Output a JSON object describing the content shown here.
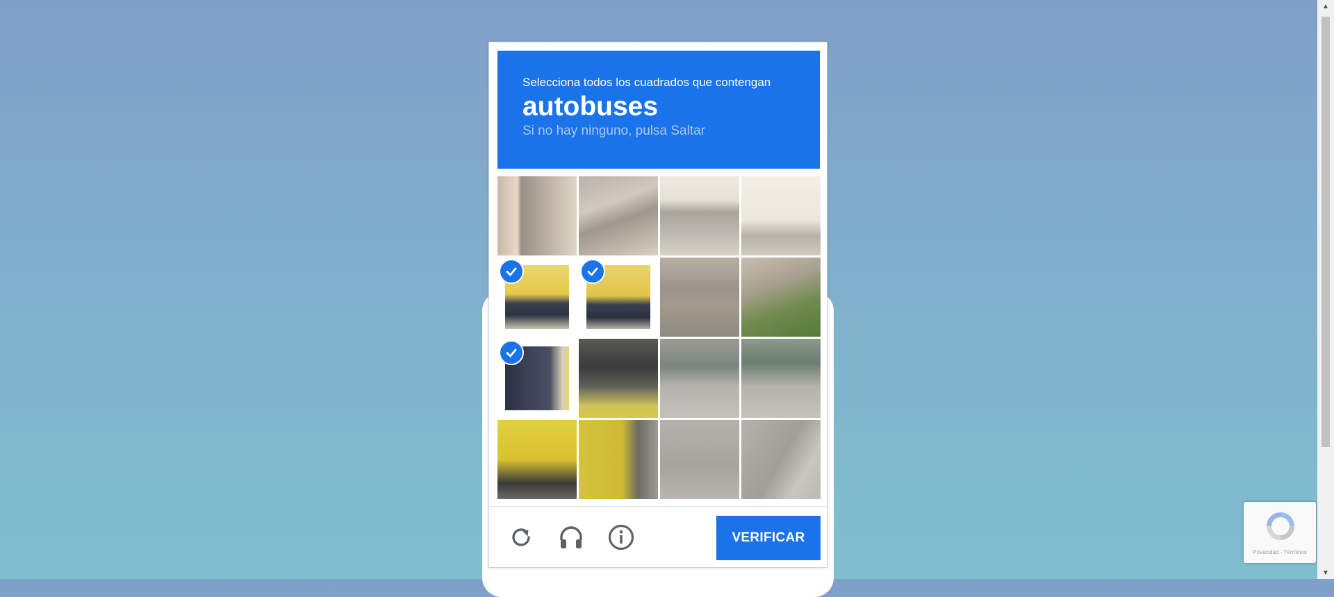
{
  "challenge": {
    "instruction": "Selecciona todos los cuadrados que contengan",
    "keyword": "autobuses",
    "hint": "Si no hay ninguno, pulsa Saltar",
    "tiles": [
      {
        "row": 1,
        "col": 1,
        "selected": false
      },
      {
        "row": 1,
        "col": 2,
        "selected": false
      },
      {
        "row": 1,
        "col": 3,
        "selected": false
      },
      {
        "row": 1,
        "col": 4,
        "selected": false
      },
      {
        "row": 2,
        "col": 1,
        "selected": true
      },
      {
        "row": 2,
        "col": 2,
        "selected": true
      },
      {
        "row": 2,
        "col": 3,
        "selected": false
      },
      {
        "row": 2,
        "col": 4,
        "selected": false
      },
      {
        "row": 3,
        "col": 1,
        "selected": true
      },
      {
        "row": 3,
        "col": 2,
        "selected": false
      },
      {
        "row": 3,
        "col": 3,
        "selected": false
      },
      {
        "row": 3,
        "col": 4,
        "selected": false
      },
      {
        "row": 4,
        "col": 1,
        "selected": false
      },
      {
        "row": 4,
        "col": 2,
        "selected": false
      },
      {
        "row": 4,
        "col": 3,
        "selected": false
      },
      {
        "row": 4,
        "col": 4,
        "selected": false
      }
    ],
    "footer": {
      "icons": [
        "reload-icon",
        "headphones-icon",
        "info-icon"
      ],
      "verify_label": "VERIFICAR"
    }
  },
  "badge": {
    "label": "Privacidad - Términos"
  },
  "colors": {
    "brand": "#1a73e8",
    "hint": "#a9c8f5",
    "background_top": "#809fc8",
    "background_bottom": "#80bfd0"
  }
}
